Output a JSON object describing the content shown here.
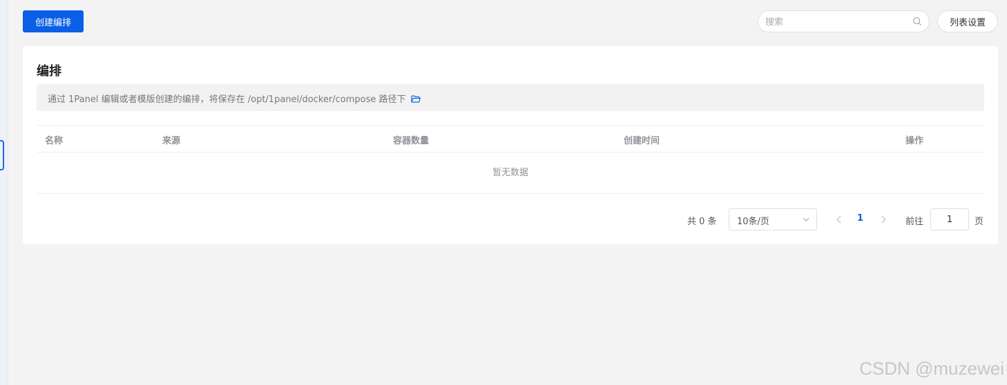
{
  "toolbar": {
    "create_label": "创建编排",
    "search_placeholder": "搜索",
    "columns_label": "列表设置"
  },
  "card": {
    "title": "编排",
    "tip": "通过 1Panel 编辑或者模版创建的编排，将保存在 /opt/1panel/docker/compose 路径下"
  },
  "table": {
    "headers": [
      "名称",
      "来源",
      "容器数量",
      "创建时间",
      "操作"
    ],
    "empty_text": "暂无数据"
  },
  "pagination": {
    "total": "共 0 条",
    "page_size": "10条/页",
    "current_page": "1",
    "goto_label": "前往",
    "jump_value": "1",
    "page_unit": "页"
  },
  "watermark": "CSDN @muzewei",
  "colors": {
    "primary": "#0b5ee6",
    "background": "#f3f3f3"
  }
}
